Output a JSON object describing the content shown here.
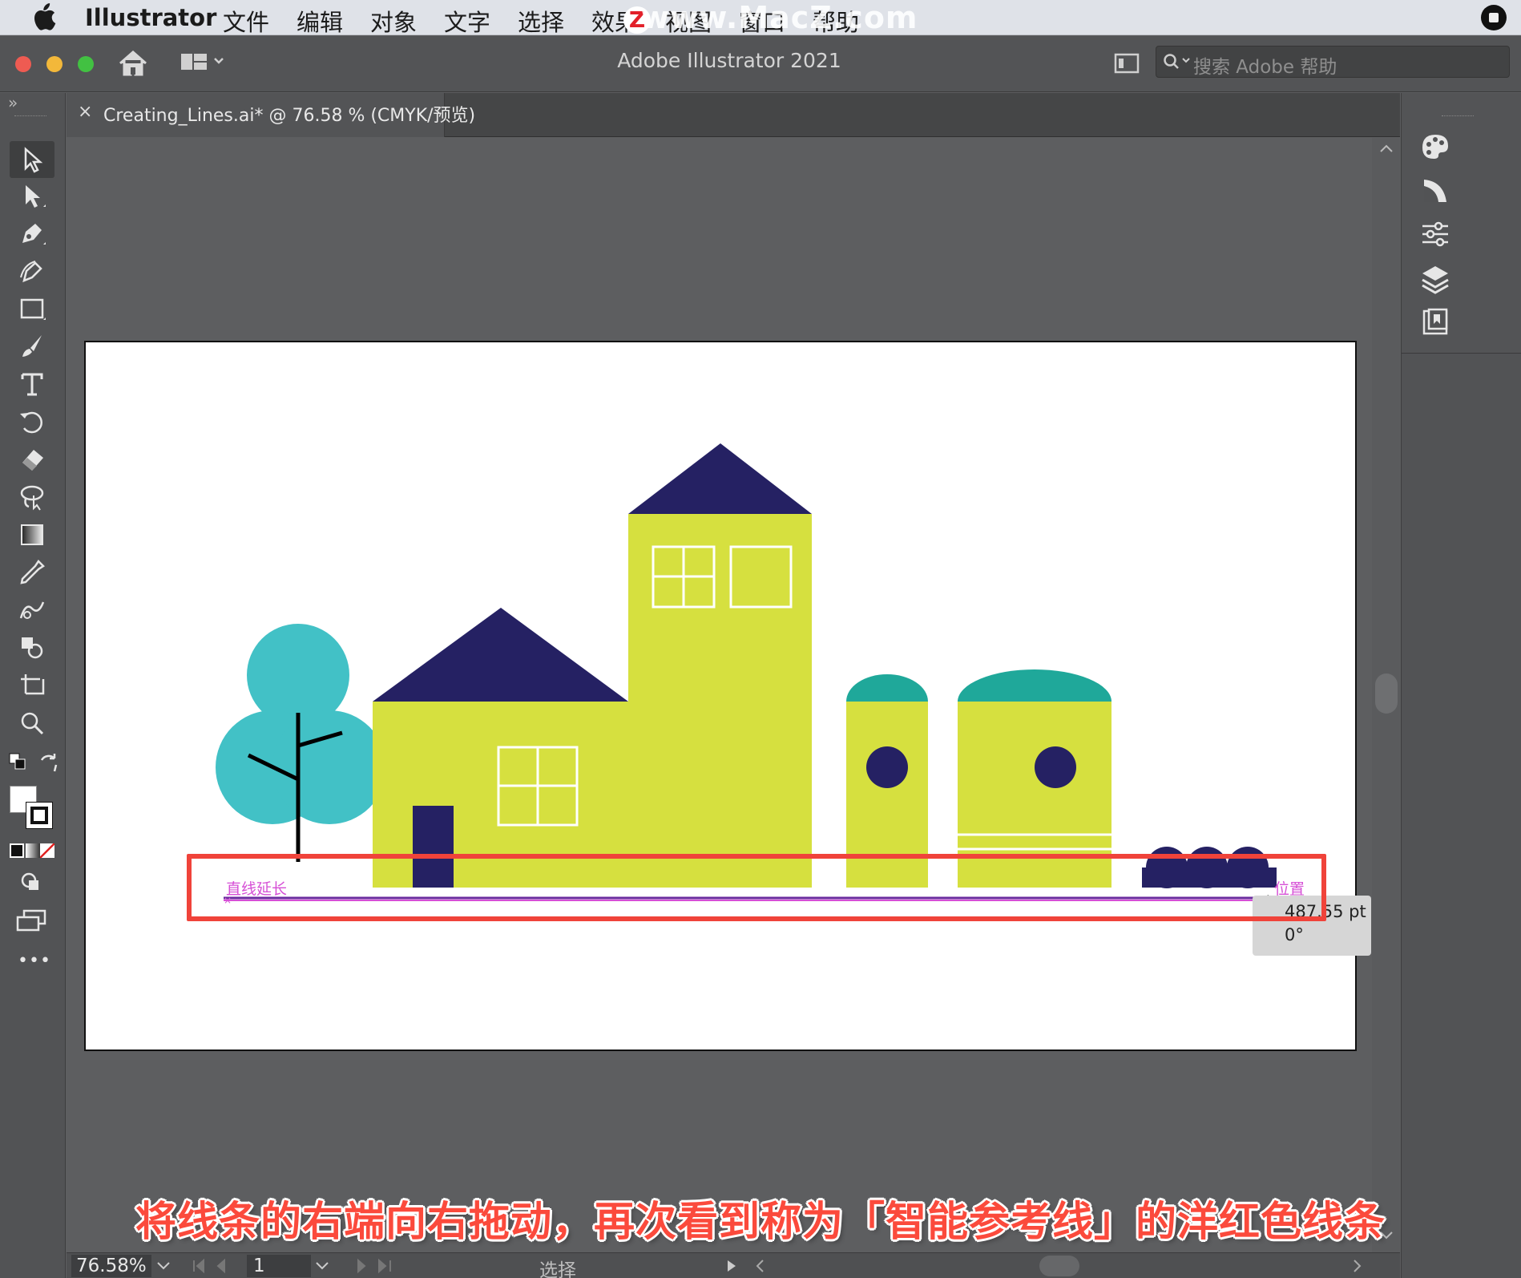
{
  "menubar": {
    "app_name": "Illustrator",
    "items": [
      "文件",
      "编辑",
      "对象",
      "文字",
      "选择",
      "效果",
      "视图",
      "窗口",
      "帮助"
    ],
    "watermark": "www.MacZ.com",
    "watermark_badge": "Z"
  },
  "window": {
    "title": "Adobe Illustrator 2021",
    "search_placeholder": "搜索 Adobe 帮助",
    "left_collapse": "»",
    "right_collapse": "«"
  },
  "tab": {
    "label": "Creating_Lines.ai* @ 76.58 % (CMYK/预览)",
    "close": "×"
  },
  "tools": [
    "selection-tool",
    "direct-selection-tool",
    "pen-tool",
    "curvature-tool",
    "rectangle-tool",
    "paintbrush-tool",
    "type-tool",
    "rotate-tool",
    "eraser-tool",
    "lasso-tool",
    "gradient-tool",
    "eyedropper-tool",
    "blend-tool",
    "shape-builder-tool",
    "artboard-tool",
    "zoom-tool"
  ],
  "more_tools": "•••",
  "smart_guide": {
    "extend_label": "直线延长",
    "position_label": "位置",
    "length": "487.55 pt",
    "angle": "0°"
  },
  "status": {
    "zoom": "76.58%",
    "page": "1",
    "mode": "选择"
  },
  "subtitle": "将线条的右端向右拖动，再次看到称为「智能参考线」的洋红色线条",
  "colors": {
    "navy": "#252163",
    "yellow": "#d6e03f",
    "teal": "#1fa89a",
    "tree": "#42c1c6",
    "magenta": "#d64fd6",
    "highlight": "#f0433a"
  }
}
